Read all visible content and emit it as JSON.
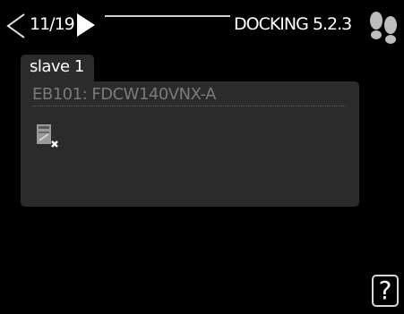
{
  "header": {
    "page_counter": "11/19",
    "menu_title": "DOCKING 5.2.3"
  },
  "tab": {
    "label": "slave 1"
  },
  "panel": {
    "unit_label": "EB101:  FDCW140VNX-A"
  },
  "help": {
    "label": "?"
  },
  "icons": {
    "prev": "left-arrow-outline-icon",
    "next": "right-arrow-filled-icon",
    "footprints": "footprints-icon",
    "unit_status": "outdoor-unit-disconnected-icon"
  },
  "colors": {
    "background": "#000000",
    "panel": "#2b2b2b",
    "dim_text": "#7a7a7a"
  }
}
